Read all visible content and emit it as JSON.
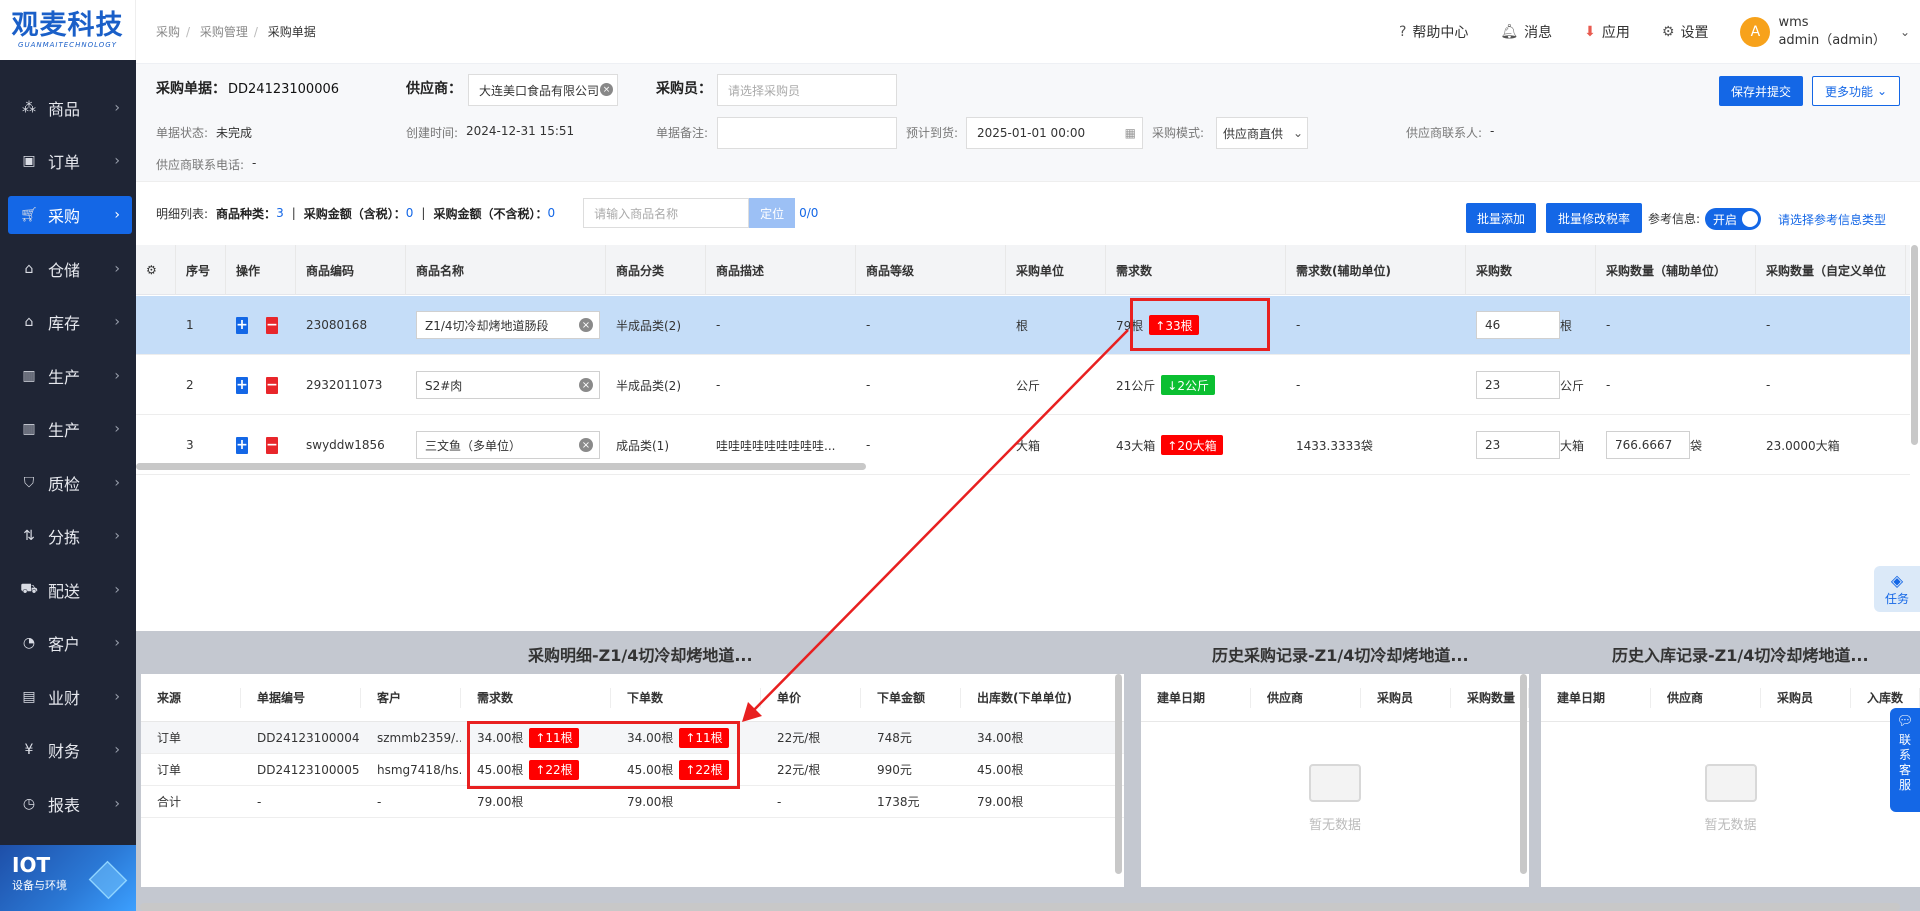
{
  "logo": {
    "main": "观麦科技",
    "sub": "GUANMAITECHNOLOGY"
  },
  "nav": [
    {
      "label": "商品",
      "icon": "grid-icon"
    },
    {
      "label": "订单",
      "icon": "order-icon"
    },
    {
      "label": "采购",
      "icon": "cart-icon",
      "active": true
    },
    {
      "label": "仓储",
      "icon": "warehouse-icon"
    },
    {
      "label": "库存",
      "icon": "stock-icon"
    },
    {
      "label": "生产",
      "icon": "factory-icon"
    },
    {
      "label": "生产",
      "icon": "factory-icon"
    },
    {
      "label": "质检",
      "icon": "shield-icon"
    },
    {
      "label": "分拣",
      "icon": "sort-icon"
    },
    {
      "label": "配送",
      "icon": "truck-icon"
    },
    {
      "label": "客户",
      "icon": "user-icon"
    },
    {
      "label": "业财",
      "icon": "chart-icon"
    },
    {
      "label": "财务",
      "icon": "finance-icon"
    },
    {
      "label": "报表",
      "icon": "report-icon"
    }
  ],
  "iot": {
    "title": "IOT",
    "subtitle": "设备与环境"
  },
  "breadcrumb": [
    "采购",
    "采购管理",
    "采购单据"
  ],
  "topbar": {
    "help": "帮助中心",
    "messages": "消息",
    "apps": "应用",
    "settings": "设置",
    "avatar": "A",
    "username": "wms",
    "account": "admin（admin）"
  },
  "form": {
    "doc_no_label": "采购单据：",
    "doc_no": "DD24123100006",
    "supplier_label": "供应商：",
    "supplier": "大连美口食品有限公司",
    "buyer_label": "采购员：",
    "buyer_placeholder": "请选择采购员",
    "status_label": "单据状态:",
    "status": "未完成",
    "created_label": "创建时间:",
    "created": "2024-12-31 15:51",
    "remark_label": "单据备注:",
    "arrival_label": "预计到货:",
    "arrival": "2025-01-01 00:00",
    "mode_label": "采购模式:",
    "mode": "供应商直供",
    "contact_label": "供应商联系人:",
    "contact": "-",
    "phone_label": "供应商联系电话:",
    "phone": "-",
    "save_btn": "保存并提交",
    "more_btn": "更多功能"
  },
  "detail": {
    "list_label": "明细列表:",
    "kinds_label": "商品种类：",
    "kinds": "3",
    "amt_tax_label": "采购金额（含税）：",
    "amt_tax": "0",
    "amt_notax_label": "采购金额（不含税）：",
    "amt_notax": "0",
    "search_placeholder": "请输入商品名称",
    "locate_btn": "定位",
    "locate_count": "0/0",
    "batch_add": "批量添加",
    "batch_tax": "批量修改税率",
    "ref_label": "参考信息:",
    "ref_toggle": "开启",
    "ref_link": "请选择参考信息类型"
  },
  "columns": [
    "序号",
    "操作",
    "商品编码",
    "商品名称",
    "商品分类",
    "商品描述",
    "商品等级",
    "采购单位",
    "需求数",
    "需求数(辅助单位)",
    "采购数",
    "采购数量（辅助单位）",
    "采购数量（自定义单位"
  ],
  "rows": [
    {
      "no": "1",
      "code": "23080168",
      "name": "Z1/4切冷却烤地道肠段",
      "cat": "半成品类(2)",
      "desc": "-",
      "grade": "-",
      "unit": "根",
      "demand": "79根",
      "tag": "↑33根",
      "tagc": "r",
      "demand_aux": "-",
      "qty": "46",
      "qty_unit": "根",
      "aux": "-",
      "aux_unit": "",
      "custom": "-"
    },
    {
      "no": "2",
      "code": "2932011073",
      "name": "S2#肉",
      "cat": "半成品类(2)",
      "desc": "-",
      "grade": "-",
      "unit": "公斤",
      "demand": "21公斤",
      "tag": "↓2公斤",
      "tagc": "g",
      "demand_aux": "-",
      "qty": "23",
      "qty_unit": "公斤",
      "aux": "-",
      "aux_unit": "",
      "custom": "-"
    },
    {
      "no": "3",
      "code": "swyddw1856",
      "name": "三文鱼（多单位）",
      "cat": "成品类(1)",
      "desc": "哇哇哇哇哇哇哇哇哇...",
      "grade": "-",
      "unit": "大箱",
      "demand": "43大箱",
      "tag": "↑20大箱",
      "tagc": "r",
      "demand_aux": "1433.3333袋",
      "qty": "23",
      "qty_unit": "大箱",
      "aux": "766.6667",
      "aux_unit": "袋",
      "custom": "23.0000大箱"
    }
  ],
  "panels": {
    "detail_title": "采购明细-Z1/4切冷却烤地道...",
    "history_title": "历史采购记录-Z1/4切冷却烤地道...",
    "inbound_title": "历史入库记录-Z1/4切冷却烤地道...",
    "detail_cols": [
      "来源",
      "单据编号",
      "客户",
      "需求数",
      "下单数",
      "单价",
      "下单金额",
      "出库数(下单单位)"
    ],
    "detail_rows": [
      {
        "src": "订单",
        "no": "DD24123100004",
        "cust": "szmmb2359/...",
        "demand": "34.00根",
        "dtag": "↑11根",
        "order": "34.00根",
        "otag": "↑11根",
        "price": "22元/根",
        "amt": "748元",
        "out": "34.00根"
      },
      {
        "src": "订单",
        "no": "DD24123100005",
        "cust": "hsmg7418/hs...",
        "demand": "45.00根",
        "dtag": "↑22根",
        "order": "45.00根",
        "otag": "↑22根",
        "price": "22元/根",
        "amt": "990元",
        "out": "45.00根"
      },
      {
        "src": "合计",
        "no": "-",
        "cust": "-",
        "demand": "79.00根",
        "dtag": "",
        "order": "79.00根",
        "otag": "",
        "price": "-",
        "amt": "1738元",
        "out": "79.00根"
      }
    ],
    "history_cols": [
      "建单日期",
      "供应商",
      "采购员",
      "采购数量"
    ],
    "inbound_cols": [
      "建单日期",
      "供应商",
      "采购员",
      "入库数"
    ],
    "empty": "暂无数据"
  },
  "task_label": "任务",
  "service_label": "联系客服",
  "colors": {
    "accent": "#1467e6",
    "sidebar": "#1f2535",
    "tag_red": "#ff0000",
    "tag_green": "#0bbf31",
    "annotation": "#e82020"
  }
}
